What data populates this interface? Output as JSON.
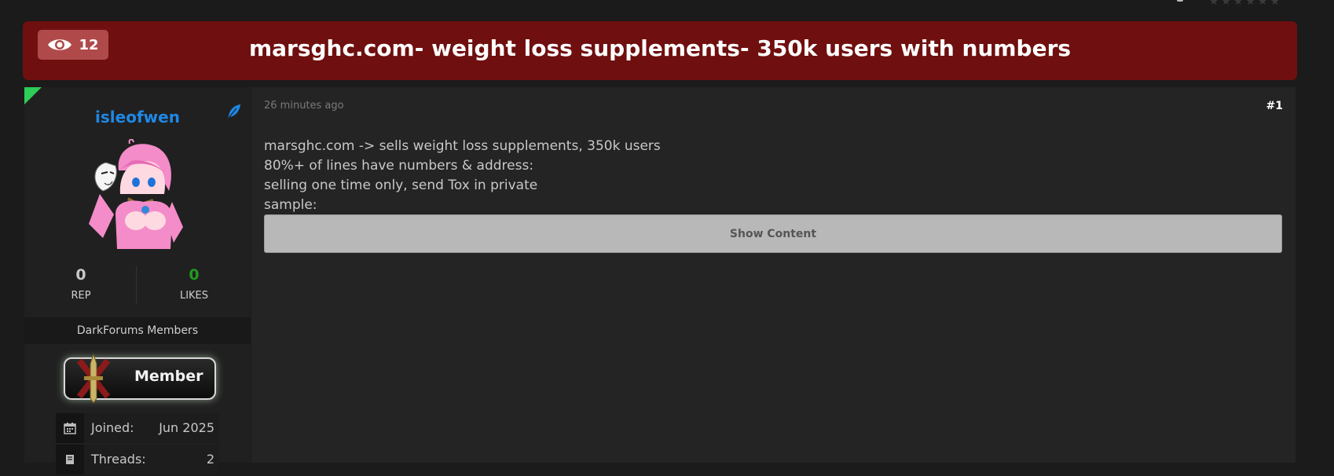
{
  "header": {
    "views_count": "12",
    "thread_title": "marsghc.com- weight loss supplements- 350k users with numbers"
  },
  "author": {
    "username": "isleofwen",
    "rep_value": "0",
    "rep_label": "REP",
    "likes_value": "0",
    "likes_label": "LIKES",
    "group": "DarkForums Members",
    "badge_label": "Member",
    "info": [
      {
        "key": "Joined:",
        "value": "Jun 2025",
        "icon": "calendar-icon"
      },
      {
        "key": "Threads:",
        "value": "2",
        "icon": "book-icon"
      }
    ]
  },
  "post": {
    "time": "26 minutes ago",
    "number": "#1",
    "lines": [
      "marsghc.com -> sells weight loss supplements, 350k users",
      "80%+ of lines have numbers & address:",
      "selling one time only, send Tox in private",
      "sample:"
    ],
    "show_content_label": "Show Content"
  },
  "colors": {
    "title_bar": "#6f0f0f",
    "views_badge": "#b04a4a",
    "username": "#1e88e5",
    "likes": "#1f9a1f",
    "online": "#2ecc58"
  }
}
